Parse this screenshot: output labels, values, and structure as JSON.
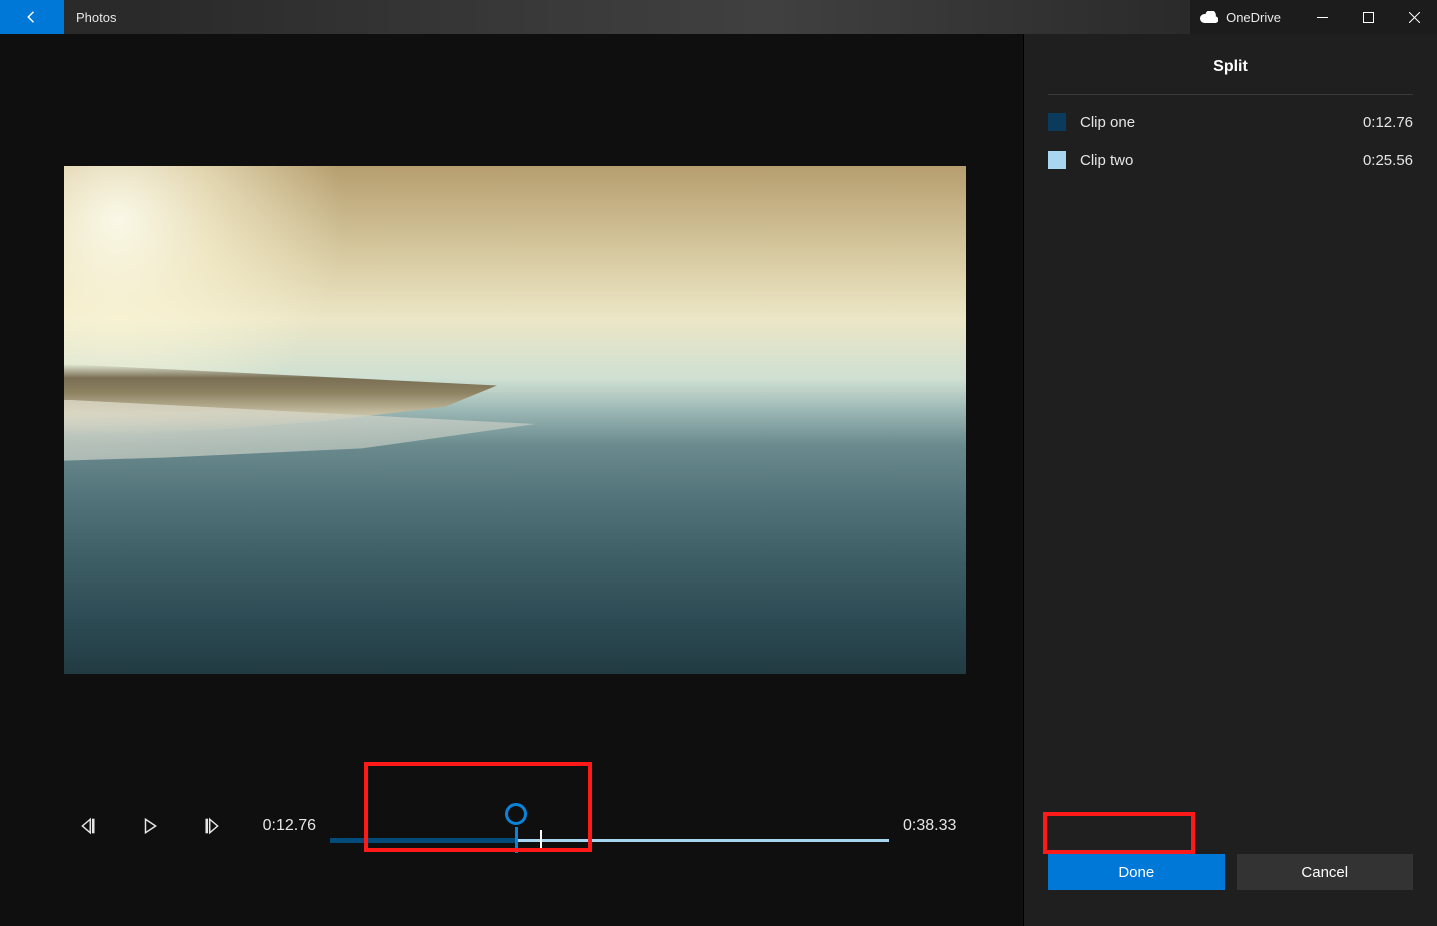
{
  "title": {
    "app_name": "Photos",
    "cloud_service": "OneDrive"
  },
  "playback": {
    "current_time": "0:12.76",
    "total_time": "0:38.33"
  },
  "sidebar": {
    "heading": "Split",
    "clips": [
      {
        "label": "Clip one",
        "duration": "0:12.76",
        "color": "#0a3a5c"
      },
      {
        "label": "Clip two",
        "duration": "0:25.56",
        "color": "#a8d6f0"
      }
    ],
    "done_label": "Done",
    "cancel_label": "Cancel"
  }
}
